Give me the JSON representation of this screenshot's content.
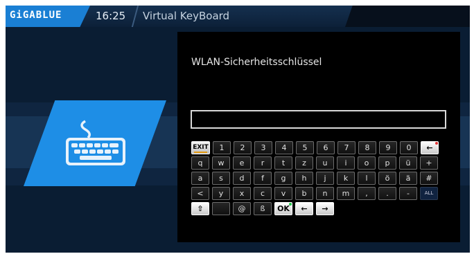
{
  "header": {
    "brand": "GiGABLUE",
    "time": "16:25",
    "title": "Virtual KeyBoard"
  },
  "dialog": {
    "title": "WLAN-Sicherheitsschlüssel",
    "input_value": ""
  },
  "keyboard": {
    "row1": [
      "EXIT",
      "1",
      "2",
      "3",
      "4",
      "5",
      "6",
      "7",
      "8",
      "9",
      "0",
      "←"
    ],
    "row2": [
      "q",
      "w",
      "e",
      "r",
      "t",
      "z",
      "u",
      "i",
      "o",
      "p",
      "ü",
      "+"
    ],
    "row3": [
      "a",
      "s",
      "d",
      "f",
      "g",
      "h",
      "j",
      "k",
      "l",
      "ö",
      "ä",
      "#"
    ],
    "row4": [
      "<",
      "y",
      "x",
      "c",
      "v",
      "b",
      "n",
      "m",
      ",",
      ".",
      "-",
      "ALL"
    ],
    "row5": [
      "⇧",
      "",
      "@",
      "ß",
      "OK",
      "←",
      "→"
    ]
  },
  "colors": {
    "brand_blue": "#1a7fd4",
    "panel_blue": "#1e8ee6",
    "background": "#0a1d33",
    "exit_underline": "#e49a11",
    "ok_dot": "#23c64b",
    "backspace_dot": "#e13636"
  },
  "icons": {
    "left_panel": "keyboard-icon"
  }
}
